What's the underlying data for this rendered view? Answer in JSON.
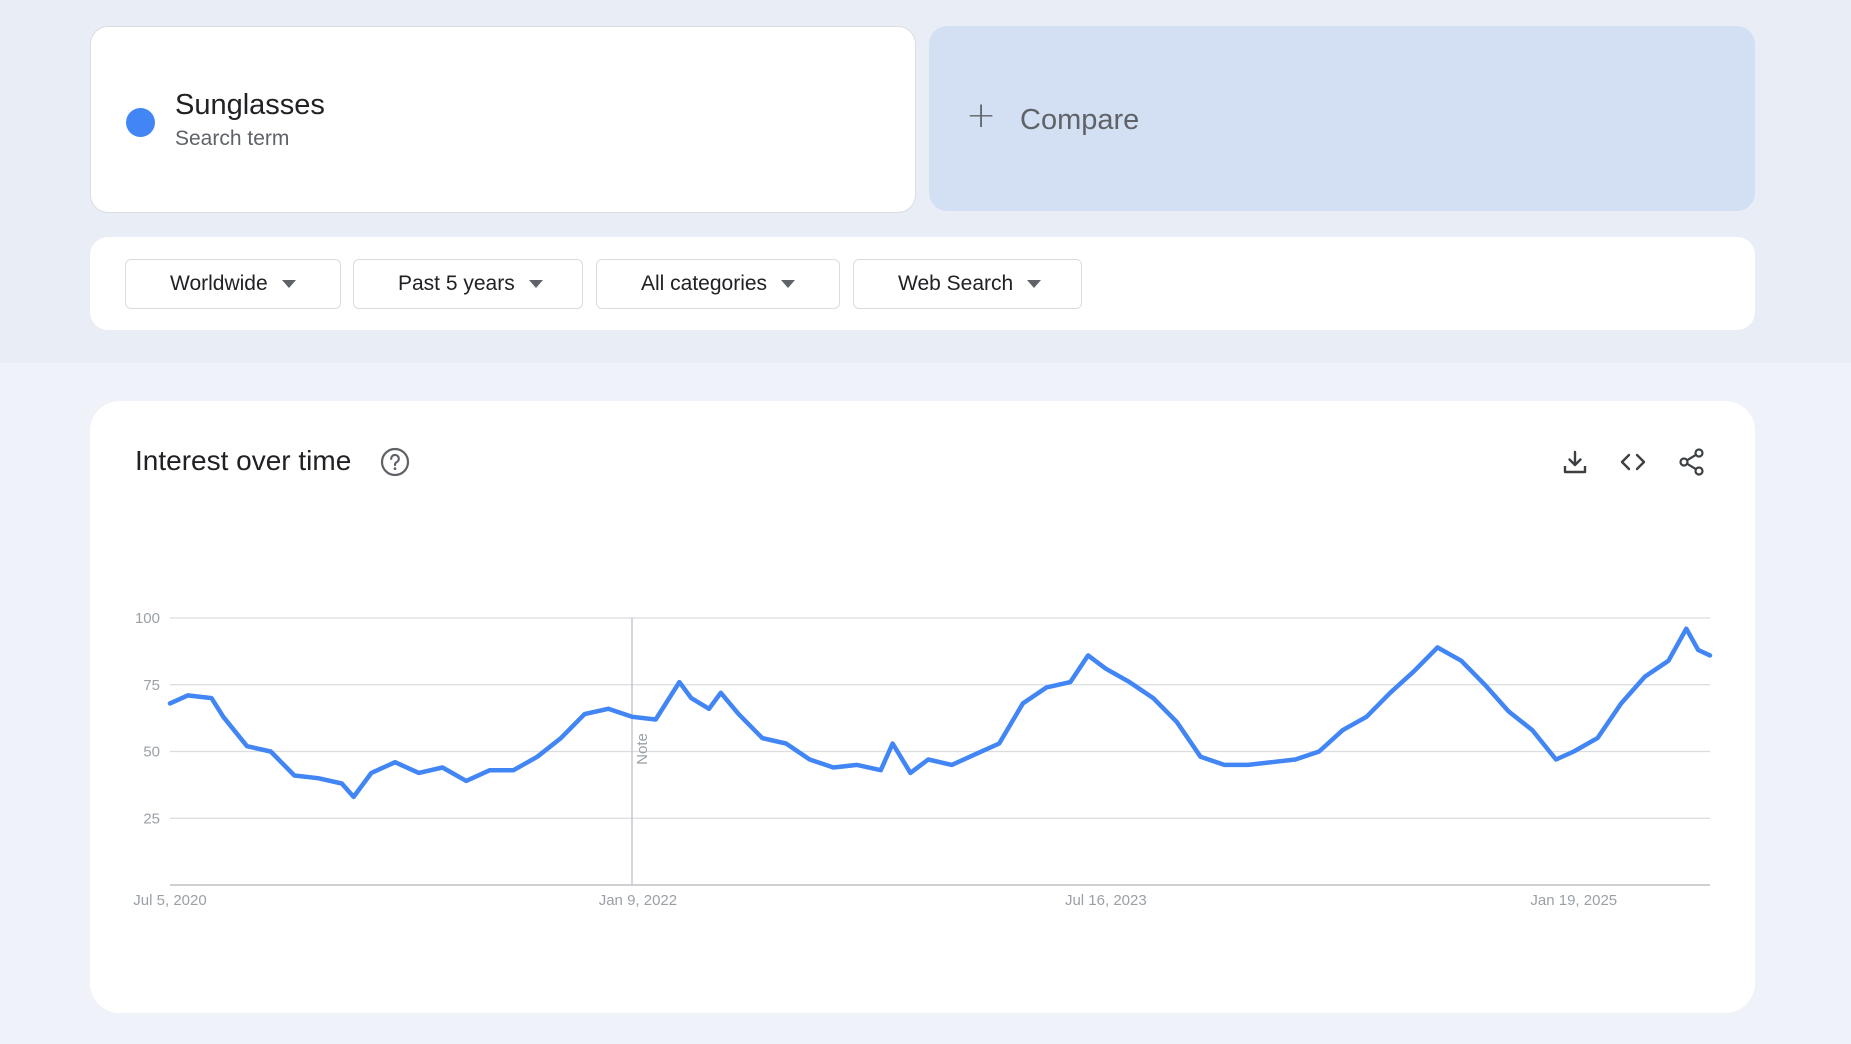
{
  "search_term": {
    "name": "Sunglasses",
    "subtitle": "Search term",
    "color": "#4285f4"
  },
  "compare": {
    "label": "Compare",
    "icon": "plus-icon"
  },
  "filters": [
    {
      "label": "Worldwide",
      "icon": "caret-down-icon"
    },
    {
      "label": "Past 5 years",
      "icon": "caret-down-icon"
    },
    {
      "label": "All categories",
      "icon": "caret-down-icon"
    },
    {
      "label": "Web Search",
      "icon": "caret-down-icon"
    }
  ],
  "chart_card": {
    "title": "Interest over time",
    "help_icon": "help-circle-icon",
    "tools": [
      "download-icon",
      "embed-code-icon",
      "share-icon"
    ]
  },
  "chart_data": {
    "type": "line",
    "title": "Interest over time",
    "xlabel": "",
    "ylabel": "",
    "ylim": [
      0,
      100
    ],
    "yticks": [
      "100",
      "75",
      "50",
      "25"
    ],
    "xticks": [
      "Jul 5, 2020",
      "Jan 9, 2022",
      "Jul 16, 2023",
      "Jan 19, 2025"
    ],
    "x_range": [
      "2020-07-05",
      "2025-06-29"
    ],
    "note": {
      "label": "Note",
      "date": "2022-01-02"
    },
    "grid": true,
    "series": [
      {
        "name": "Sunglasses",
        "color": "#4285f4",
        "points": [
          [
            "2020-07-05",
            68
          ],
          [
            "2020-07-26",
            71
          ],
          [
            "2020-08-23",
            70
          ],
          [
            "2020-09-06",
            63
          ],
          [
            "2020-10-04",
            52
          ],
          [
            "2020-11-01",
            50
          ],
          [
            "2020-11-29",
            41
          ],
          [
            "2020-12-27",
            40
          ],
          [
            "2021-01-24",
            38
          ],
          [
            "2021-02-07",
            33
          ],
          [
            "2021-02-28",
            42
          ],
          [
            "2021-03-28",
            46
          ],
          [
            "2021-04-25",
            42
          ],
          [
            "2021-05-23",
            44
          ],
          [
            "2021-06-20",
            39
          ],
          [
            "2021-07-18",
            43
          ],
          [
            "2021-08-15",
            43
          ],
          [
            "2021-09-12",
            48
          ],
          [
            "2021-10-10",
            55
          ],
          [
            "2021-11-07",
            64
          ],
          [
            "2021-12-05",
            66
          ],
          [
            "2022-01-02",
            63
          ],
          [
            "2022-01-30",
            62
          ],
          [
            "2022-02-27",
            76
          ],
          [
            "2022-03-13",
            70
          ],
          [
            "2022-04-03",
            66
          ],
          [
            "2022-04-17",
            72
          ],
          [
            "2022-05-08",
            64
          ],
          [
            "2022-06-05",
            55
          ],
          [
            "2022-07-03",
            53
          ],
          [
            "2022-07-31",
            47
          ],
          [
            "2022-08-28",
            44
          ],
          [
            "2022-09-25",
            45
          ],
          [
            "2022-10-23",
            43
          ],
          [
            "2022-11-06",
            53
          ],
          [
            "2022-11-27",
            42
          ],
          [
            "2022-12-18",
            47
          ],
          [
            "2023-01-15",
            45
          ],
          [
            "2023-02-12",
            49
          ],
          [
            "2023-03-12",
            53
          ],
          [
            "2023-04-09",
            68
          ],
          [
            "2023-05-07",
            74
          ],
          [
            "2023-06-04",
            76
          ],
          [
            "2023-06-25",
            86
          ],
          [
            "2023-07-16",
            81
          ],
          [
            "2023-08-13",
            76
          ],
          [
            "2023-09-10",
            70
          ],
          [
            "2023-10-08",
            61
          ],
          [
            "2023-11-05",
            48
          ],
          [
            "2023-12-03",
            45
          ],
          [
            "2023-12-31",
            45
          ],
          [
            "2024-01-28",
            46
          ],
          [
            "2024-02-25",
            47
          ],
          [
            "2024-03-24",
            50
          ],
          [
            "2024-04-21",
            58
          ],
          [
            "2024-05-19",
            63
          ],
          [
            "2024-06-16",
            72
          ],
          [
            "2024-07-14",
            80
          ],
          [
            "2024-08-11",
            89
          ],
          [
            "2024-09-08",
            84
          ],
          [
            "2024-10-06",
            75
          ],
          [
            "2024-11-03",
            65
          ],
          [
            "2024-12-01",
            58
          ],
          [
            "2024-12-29",
            47
          ],
          [
            "2025-01-19",
            50
          ],
          [
            "2025-02-16",
            55
          ],
          [
            "2025-03-16",
            68
          ],
          [
            "2025-04-13",
            78
          ],
          [
            "2025-05-11",
            84
          ],
          [
            "2025-06-01",
            96
          ],
          [
            "2025-06-15",
            88
          ],
          [
            "2025-06-29",
            86
          ]
        ]
      }
    ]
  }
}
